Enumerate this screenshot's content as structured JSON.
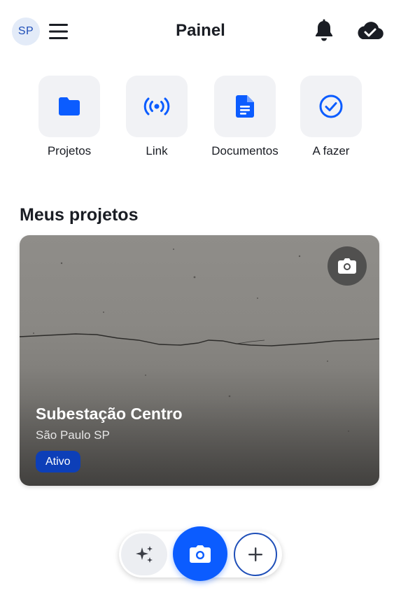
{
  "header": {
    "avatar_initials": "SP",
    "title": "Painel",
    "icons": [
      "menu-icon",
      "bell-icon",
      "cloud-check-icon"
    ]
  },
  "quick_actions": [
    {
      "label": "Projetos",
      "icon": "folder-icon"
    },
    {
      "label": "Link",
      "icon": "broadcast-icon"
    },
    {
      "label": "Documentos",
      "icon": "document-icon"
    },
    {
      "label": "A fazer",
      "icon": "check-circle-icon"
    }
  ],
  "section": {
    "title": "Meus projetos"
  },
  "project_card": {
    "title": "Subestação Centro",
    "location": "São Paulo SP",
    "status": "Ativo",
    "icon": "camera-icon"
  },
  "bottom_bar": {
    "icons": [
      "sparkles-icon",
      "camera-icon",
      "plus-icon"
    ]
  },
  "colors": {
    "accent": "#0b5cff",
    "brand_blue": "#0d3fb8",
    "tile_bg": "#f1f2f5",
    "text": "#1a1d24"
  }
}
